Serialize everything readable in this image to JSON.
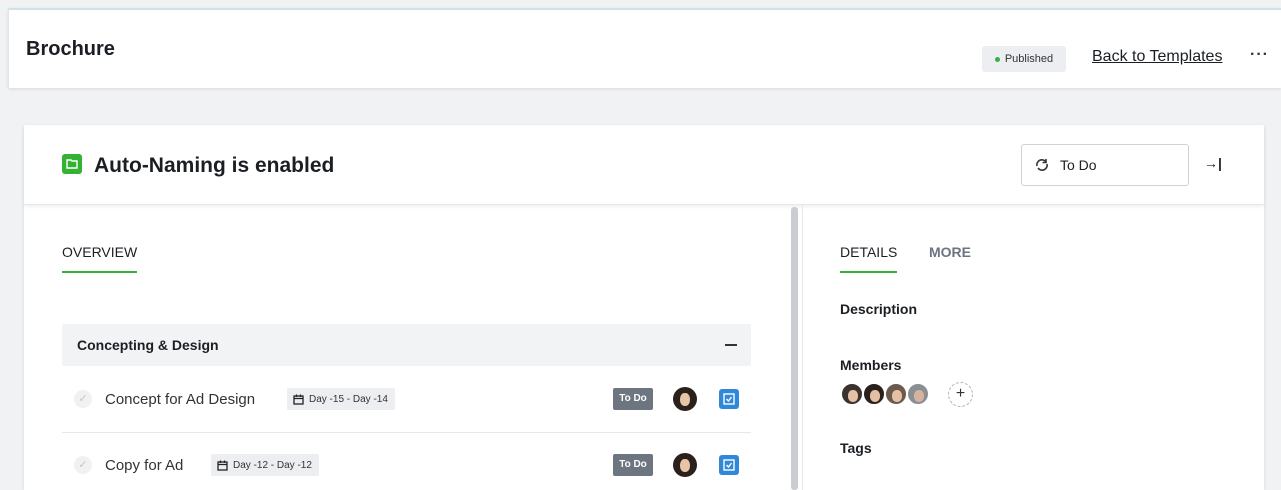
{
  "header": {
    "title": "Brochure",
    "status_badge": "Published",
    "back_link": "Back to Templates",
    "more_menu": "···"
  },
  "project": {
    "title": "Auto-Naming is enabled",
    "status_select": "To Do",
    "collapse_icon": "→|"
  },
  "left_tabs": [
    {
      "label": "OVERVIEW",
      "active": true
    }
  ],
  "section": {
    "label": "Concepting & Design",
    "collapse_icon": "—"
  },
  "tasks": [
    {
      "name": "Concept for Ad Design",
      "date": "Day -15 - Day -14",
      "status": "To Do"
    },
    {
      "name": "Copy for Ad",
      "date": "Day -12 - Day -12",
      "status": "To Do"
    }
  ],
  "right_tabs": [
    {
      "label": "DETAILS",
      "active": true
    },
    {
      "label": "MORE",
      "active": false
    }
  ],
  "details": {
    "description_label": "Description",
    "members_label": "Members",
    "add_member": "+",
    "tags_label": "Tags"
  },
  "colors": {
    "accent_green": "#34b233",
    "task_link_blue": "#2f88d8",
    "todo_chip": "#6d7680"
  },
  "icons": {
    "folder": "folder-icon",
    "status": "status-icon",
    "collapse_panel": "collapse-panel-icon",
    "calendar": "calendar-icon",
    "check": "check-icon",
    "task_link": "task-link-icon"
  }
}
